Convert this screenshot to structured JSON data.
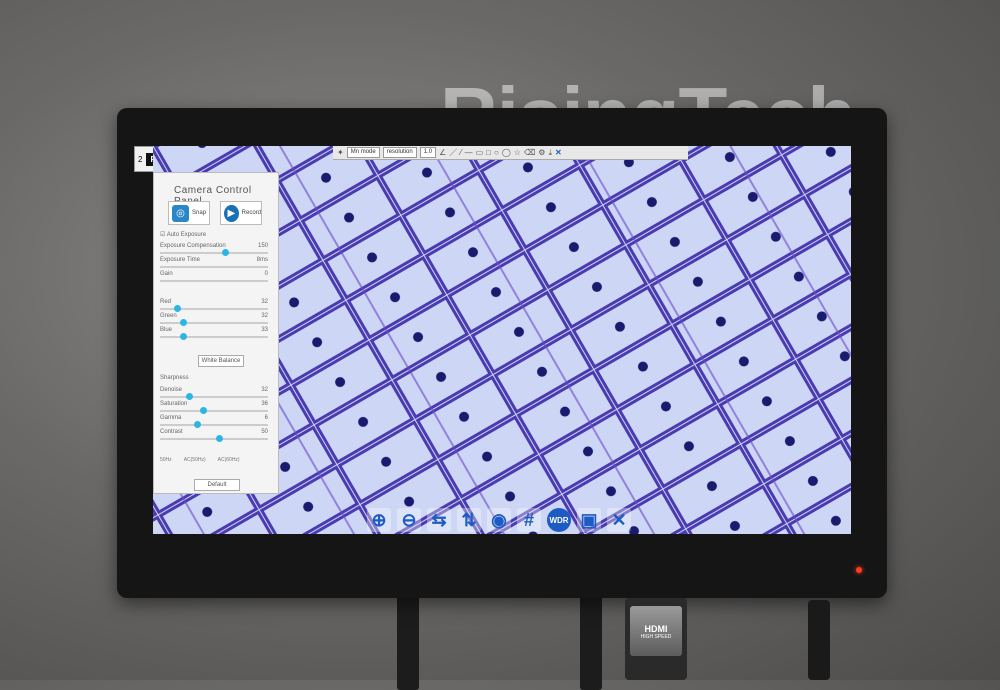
{
  "watermark": "RisingTech",
  "label": {
    "number": "2",
    "text": "FRONT"
  },
  "toolbar": {
    "select1": "Mn mode",
    "select2": "resolution",
    "select3": "1.0",
    "icons": [
      "pin-icon",
      "angle-icon",
      "line-icon",
      "polyline-icon",
      "dash-icon",
      "rect-icon",
      "square-icon",
      "circle-icon",
      "ellipse-icon",
      "star-icon",
      "eraser-icon",
      "calibrate-icon",
      "export-icon",
      "close-icon"
    ]
  },
  "panel": {
    "title": "Camera Control Panel",
    "snap_label": "Snap",
    "record_label": "Record",
    "auto_exposure": "Auto Exposure",
    "sliders": [
      {
        "label": "Exposure Compensation",
        "value": "150"
      },
      {
        "label": "Exposure Time",
        "value": "8ms"
      },
      {
        "label": "Gain",
        "value": "0"
      },
      {
        "label": "Red",
        "value": "32"
      },
      {
        "label": "Green",
        "value": "32"
      },
      {
        "label": "Blue",
        "value": "33"
      }
    ],
    "white_balance": "White Balance",
    "sharpness": "Sharpness",
    "sliders2": [
      {
        "label": "Denoise",
        "value": "32"
      },
      {
        "label": "Saturation",
        "value": "36"
      },
      {
        "label": "Gamma",
        "value": "6"
      },
      {
        "label": "Contrast",
        "value": "50"
      }
    ],
    "radios": [
      "50Hz",
      "AC(50Hz)",
      "AC(60Hz)"
    ],
    "default_btn": "Default"
  },
  "bottom_bar": {
    "icons": [
      "zoom-in-icon",
      "zoom-out-icon",
      "flip-h-icon",
      "flip-v-icon",
      "stop-icon",
      "grid-icon",
      "wdr-icon",
      "save-icon",
      "settings-icon"
    ],
    "glyphs": [
      "⊕",
      "⊖",
      "⇆",
      "⇅",
      "◉",
      "#",
      "WDR",
      "▣",
      "✕"
    ]
  },
  "hdmi": {
    "brand": "HDMI",
    "sub": "HIGH SPEED"
  }
}
